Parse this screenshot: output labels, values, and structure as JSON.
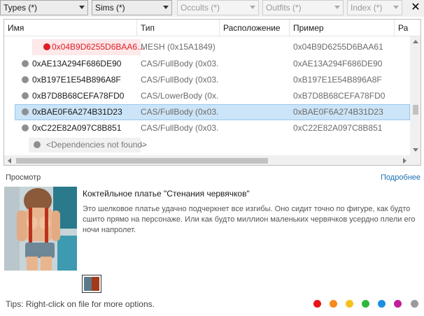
{
  "filters": [
    {
      "label": "Types (*)",
      "enabled": true
    },
    {
      "label": "Sims (*)",
      "enabled": true
    },
    {
      "label": "Occults (*)",
      "enabled": false
    },
    {
      "label": "Outfits (*)",
      "enabled": false
    },
    {
      "label": "Index (*)",
      "enabled": false
    }
  ],
  "close_label": "✕",
  "columns": [
    "Имя",
    "Тип",
    "Расположение",
    "Пример",
    "Ра"
  ],
  "rows": [
    {
      "name": "0x04B9D6255D6BAA6...",
      "type": "MESH (0x15A1849)",
      "sample": "0x04B9D6255D6BAA61",
      "style": "red"
    },
    {
      "name": "0xAE13A294F686DE90",
      "type": "CAS/FullBody (0x03...",
      "sample": "0xAE13A294F686DE90",
      "style": "normal"
    },
    {
      "name": "0xB197E1E54B896A8F",
      "type": "CAS/FullBody (0x03...",
      "sample": "0xB197E1E54B896A8F",
      "style": "normal"
    },
    {
      "name": "0xB7D8B68CEFA78FD0",
      "type": "CAS/LowerBody (0x...",
      "sample": "0xB7D8B68CEFA78FD0",
      "style": "normal"
    },
    {
      "name": "0xBAE0F6A274B31D23",
      "type": "CAS/FullBody (0x03...",
      "sample": "0xBAE0F6A274B31D23",
      "style": "selected"
    },
    {
      "name": "0xC22E82A097C8B851",
      "type": "CAS/FullBody (0x03...",
      "sample": "0xC22E82A097C8B851",
      "style": "normal"
    },
    {
      "name": "<Dependencies not found>",
      "type": "--",
      "sample": "",
      "style": "dep"
    }
  ],
  "preview": {
    "label": "Просмотр",
    "details_link": "Подробнее",
    "title": "Коктейльное платье \"Стенания червячков\"",
    "description": "Это шелковое платье удачно подчеркнет все изгибы. Оно сидит точно по фигуре, как будто сшито прямо на персонаже. Или как будто миллион маленьких червячков усердно плели его ночи напролет."
  },
  "tips": "Tips:  Right-click on file for more options.",
  "color_filters": [
    "#e8141c",
    "#f58a1f",
    "#f5c21b",
    "#2db83d",
    "#1e8fe0",
    "#c21e9c",
    "#9a9a9a"
  ]
}
